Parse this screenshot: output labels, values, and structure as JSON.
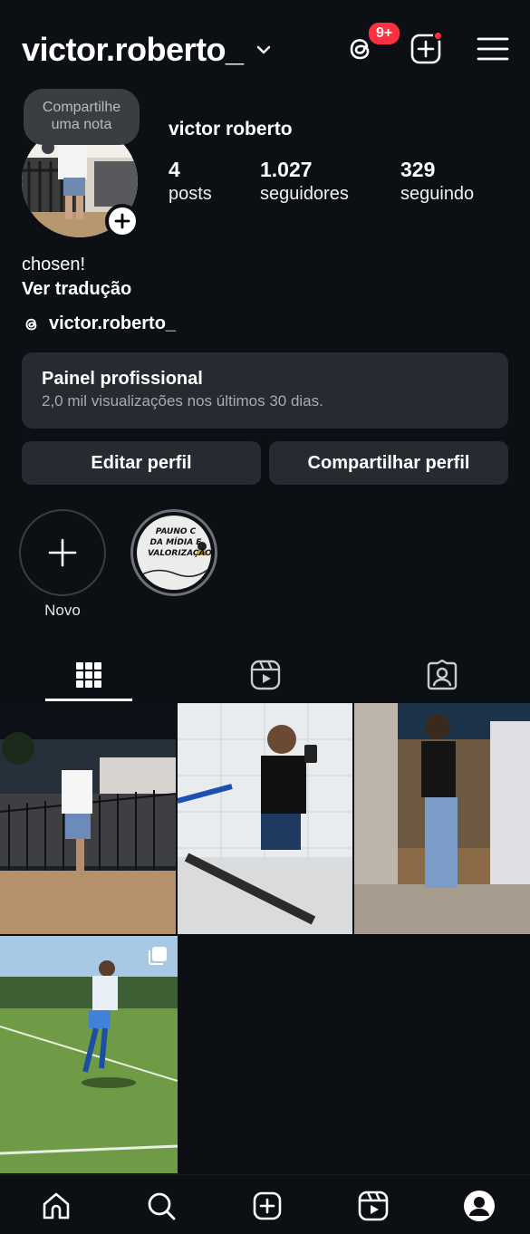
{
  "header": {
    "username": "victor.roberto_",
    "threads_badge": "9+",
    "icons": [
      "threads-icon",
      "create-icon",
      "menu-icon"
    ],
    "accent_color": "#ff3040"
  },
  "profile": {
    "note_text": "Compartilhe uma nota",
    "full_name": "victor roberto",
    "stats": [
      {
        "value": "4",
        "label": "posts"
      },
      {
        "value": "1.027",
        "label": "seguidores"
      },
      {
        "value": "329",
        "label": "seguindo"
      }
    ],
    "bio": "chosen!",
    "translate_label": "Ver tradução",
    "threads_handle": "victor.roberto_"
  },
  "panel": {
    "title": "Painel profissional",
    "subtitle": "2,0 mil visualizações nos últimos 30 dias."
  },
  "actions": {
    "edit_label": "Editar perfil",
    "share_label": "Compartilhar perfil"
  },
  "highlights": {
    "new_label": "Novo",
    "items": [
      {
        "cover_text": "PAUNO C DA MÍDIA E VALORIZAÇÃO"
      }
    ]
  },
  "tabs": [
    "grid-icon",
    "reels-icon",
    "tagged-icon"
  ],
  "posts": [
    {
      "description": "balcony photo at night"
    },
    {
      "description": "mirror selfie"
    },
    {
      "description": "standing photo"
    },
    {
      "description": "soccer match photo"
    }
  ],
  "nav": [
    "home-icon",
    "search-icon",
    "create-icon",
    "reels-icon",
    "profile-icon"
  ]
}
